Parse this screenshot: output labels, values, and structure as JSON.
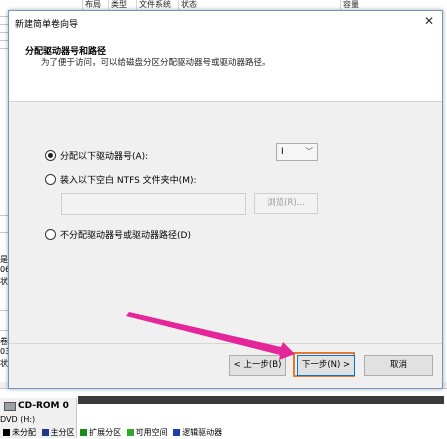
{
  "background_table": {
    "columns": [
      "布局",
      "类型",
      "文件系统",
      "状态",
      "容量"
    ]
  },
  "background_panel": {
    "left_fragments": [
      "是",
      "06",
      "状",
      "卷",
      "03",
      "状"
    ],
    "cdrom_label": "CD-ROM 0",
    "cdrom_sub": "DVD (H:)",
    "legend": [
      {
        "label": "未分配",
        "color": "#000000"
      },
      {
        "label": "主分区",
        "color": "#1f3a8a"
      },
      {
        "label": "扩展分区",
        "color": "#1a8a1a"
      },
      {
        "label": "可用空间",
        "color": "#2fa82f"
      },
      {
        "label": "逻辑驱动器",
        "color": "#1c3fae"
      }
    ]
  },
  "dialog": {
    "title": "新建简单卷向导",
    "step_title": "分配驱动器号和路径",
    "step_description": "为了便于访问，可以给磁盘分区分配驱动器号或驱动器路径。",
    "option_assign_letter": "分配以下驱动器号(A):",
    "option_mount_folder": "装入以下空白 NTFS 文件夹中(M):",
    "option_no_letter": "不分配驱动器号或驱动器路径(D)",
    "selected_option": "assign_letter",
    "drive_letter_value": "I",
    "folder_path_value": "",
    "browse_label": "浏览(R)...",
    "back_label": "< 上一步(B)",
    "next_label": "下一步(N) >",
    "cancel_label": "取消"
  },
  "annotation": {
    "arrow_color": "#e5259a",
    "highlight_color": "#e8792b"
  }
}
